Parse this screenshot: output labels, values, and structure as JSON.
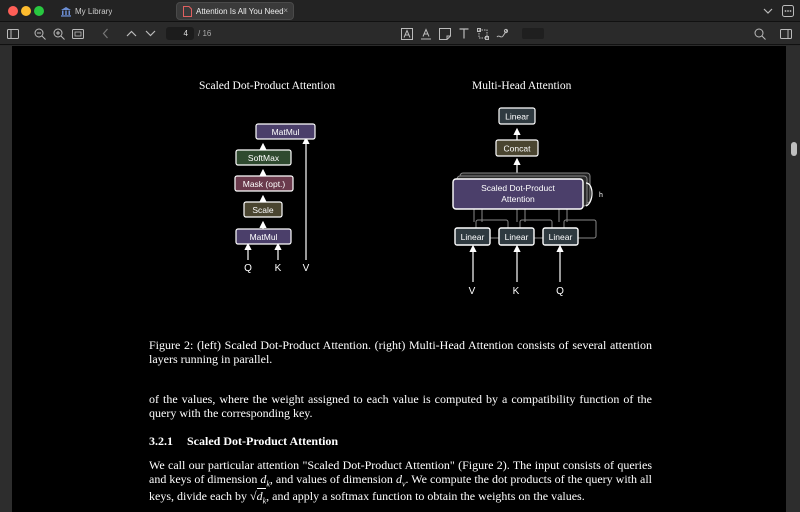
{
  "window": {
    "library_tab": "My Library",
    "active_tab": "Attention Is All You Need",
    "close_glyph": "×"
  },
  "toolbar": {
    "current_page": "4",
    "total_pages": "/ 16"
  },
  "figure": {
    "left_title": "Scaled Dot-Product Attention",
    "right_title": "Multi-Head Attention",
    "left_boxes": {
      "matmul_top": "MatMul",
      "softmax": "SoftMax",
      "mask": "Mask (opt.)",
      "scale": "Scale",
      "matmul_bottom": "MatMul"
    },
    "left_inputs": [
      "Q",
      "K",
      "V"
    ],
    "right_boxes": {
      "linear_top": "Linear",
      "concat": "Concat",
      "sdpa_line1": "Scaled Dot-Product",
      "sdpa_line2": "Attention",
      "linear_v": "Linear",
      "linear_k": "Linear",
      "linear_q": "Linear",
      "h": "h"
    },
    "right_inputs": [
      "V",
      "K",
      "Q"
    ]
  },
  "document": {
    "caption": "Figure 2: (left) Scaled Dot-Product Attention. (right) Multi-Head Attention consists of several attention layers running in parallel.",
    "para1": "of the values, where the weight assigned to each value is computed by a compatibility function of the query with the corresponding key.",
    "heading_num": "3.2.1",
    "heading_text": "Scaled Dot-Product Attention",
    "para2": {
      "a": "We call our particular attention \"Scaled Dot-Product Attention\" (Figure 2). The input consists of queries and keys of dimension ",
      "dk": "d",
      "dk_sub": "k",
      "b": ", and values of dimension ",
      "dv": "d",
      "dv_sub": "v",
      "c": ". We compute the dot products of the query with all keys, divide each by ",
      "sqrt": "√",
      "sqrt_d": "d",
      "sqrt_sub": "k",
      "d": ", and apply a softmax function to obtain the weights on the values."
    }
  },
  "colors": {
    "matmul": "#4b3f6a",
    "softmax": "#2f4a2f",
    "mask": "#6a3a4c",
    "scale": "#4a4530",
    "linear": "#2f3a40",
    "concat": "#4a4530"
  }
}
